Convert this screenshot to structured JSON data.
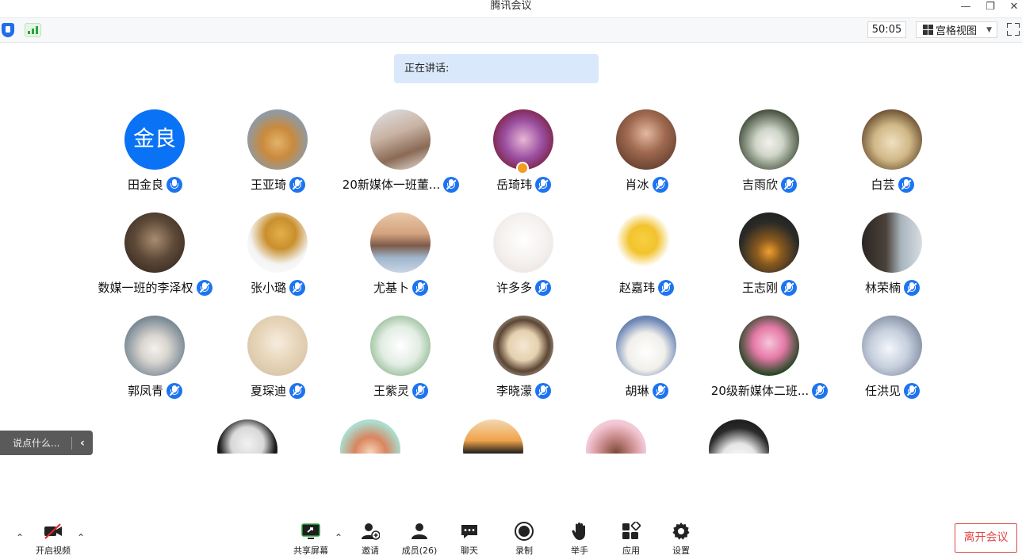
{
  "window": {
    "title": "腾讯会议",
    "minimize": "—",
    "restore": "❐",
    "close": "✕"
  },
  "toolbar": {
    "timer": "50:05",
    "view_label": "宫格视图",
    "view_caret": "▼"
  },
  "speaking": {
    "label": "正在讲话:"
  },
  "participants": [
    {
      "name": "田金良",
      "initials": "金良"
    },
    {
      "name": "王亚琦"
    },
    {
      "name": "20新媒体一班董..."
    },
    {
      "name": "岳琦玮"
    },
    {
      "name": "肖冰"
    },
    {
      "name": "吉雨欣"
    },
    {
      "name": "白芸"
    },
    {
      "name": "数媒一班的李泽权"
    },
    {
      "name": "张小璐"
    },
    {
      "name": "尤基卜"
    },
    {
      "name": "许多多"
    },
    {
      "name": "赵嘉玮"
    },
    {
      "name": "王志刚"
    },
    {
      "name": "林荣楠"
    },
    {
      "name": "郭凤青"
    },
    {
      "name": "夏琛迪"
    },
    {
      "name": "王紫灵"
    },
    {
      "name": "李晓濛"
    },
    {
      "name": "胡琳"
    },
    {
      "name": "20级新媒体二班..."
    },
    {
      "name": "任洪见"
    }
  ],
  "chat": {
    "placeholder": "说点什么...",
    "arrow": "‹"
  },
  "bottombar": {
    "video": "开启视频",
    "share": "共享屏幕",
    "invite": "邀请",
    "members": "成员(26)",
    "chat": "聊天",
    "record": "录制",
    "raise_hand": "举手",
    "apps": "应用",
    "settings": "设置",
    "leave": "离开会议",
    "chevron": "⌃"
  },
  "colors": {
    "accent": "#1d74f0",
    "leave": "#e64545",
    "avatar_initials_bg": "#0a72f5"
  }
}
